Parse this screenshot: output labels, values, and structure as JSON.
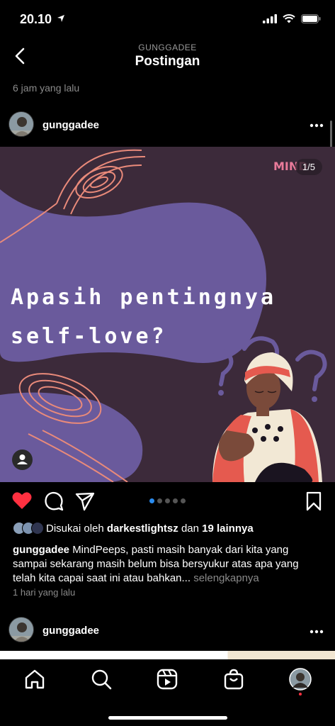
{
  "status_bar": {
    "time": "20.10"
  },
  "header": {
    "account": "GUNGGADEE",
    "title": "Postingan"
  },
  "previous_post": {
    "time_ago": "6 jam yang lalu"
  },
  "post": {
    "username": "gunggadee",
    "slide_counter": "1/5",
    "slide_count": 5,
    "active_slide": 1,
    "image": {
      "headline_line1": "Apasih pentingnya",
      "headline_line2": "self-love?",
      "brand_mark": "MIND"
    },
    "likes": {
      "prefix": "Disukai oleh",
      "user": "darkestlightsz",
      "connector": "dan",
      "others": "19 lainnya"
    },
    "caption": {
      "username": "gunggadee",
      "text": "MindPeeps, pasti masih banyak dari kita yang sampai sekarang masih belum bisa bersyukur atas apa yang telah kita capai saat ini atau bahkan...",
      "more": "selengkapnya"
    },
    "time_ago": "1 hari yang lalu",
    "liked": true
  },
  "next_post": {
    "username": "gunggadee"
  },
  "colors": {
    "background": "#000000",
    "like_red": "#ff3040",
    "dot_active": "#2a8cf0",
    "post_bg": "#3c2a3a",
    "blob_purple": "#6a5a9c",
    "line_salmon": "#e98a7a"
  },
  "icons": [
    "back-icon",
    "more-icon",
    "heart-icon",
    "comment-icon",
    "share-icon",
    "bookmark-icon",
    "home-icon",
    "search-icon",
    "reels-icon",
    "shop-icon",
    "profile-icon"
  ]
}
